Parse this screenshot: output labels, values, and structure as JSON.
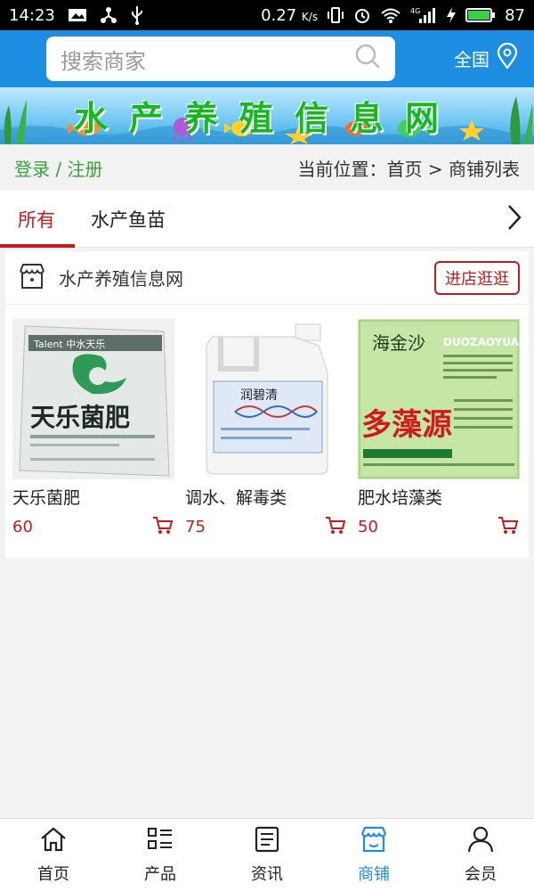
{
  "status": {
    "time": "14:23",
    "speed": "0.27",
    "speed_unit": "K/s",
    "battery": "87",
    "network": "4G"
  },
  "header": {
    "search_placeholder": "搜索商家",
    "region": "全国"
  },
  "banner": {
    "title": "水产养殖信息网"
  },
  "crumb": {
    "login": "登录 / 注册",
    "location": "当前位置：首页 > 商铺列表"
  },
  "tabs": [
    {
      "label": "所有"
    },
    {
      "label": "水产鱼苗"
    }
  ],
  "shop": {
    "name": "水产养殖信息网",
    "enter_label": "进店逛逛",
    "products": [
      {
        "name": "天乐菌肥",
        "price": "60",
        "img_text_1": "Talent 中水天乐",
        "img_text_2": "天乐菌肥"
      },
      {
        "name": "调水、解毒类",
        "price": "75",
        "img_text_1": "润碧清"
      },
      {
        "name": "肥水培藻类",
        "price": "50",
        "img_text_1": "海金沙",
        "img_text_2": "DUOZAOYUAN",
        "img_text_3": "多藻源"
      }
    ]
  },
  "nav": [
    {
      "label": "首页",
      "icon": "home-icon"
    },
    {
      "label": "产品",
      "icon": "list-icon"
    },
    {
      "label": "资讯",
      "icon": "news-icon"
    },
    {
      "label": "商铺",
      "icon": "shop-icon",
      "active": true
    },
    {
      "label": "会员",
      "icon": "user-icon"
    }
  ],
  "colors": {
    "brand": "#1e8ee3",
    "accent_red": "#c41a1a",
    "login_green": "#37a33b"
  }
}
